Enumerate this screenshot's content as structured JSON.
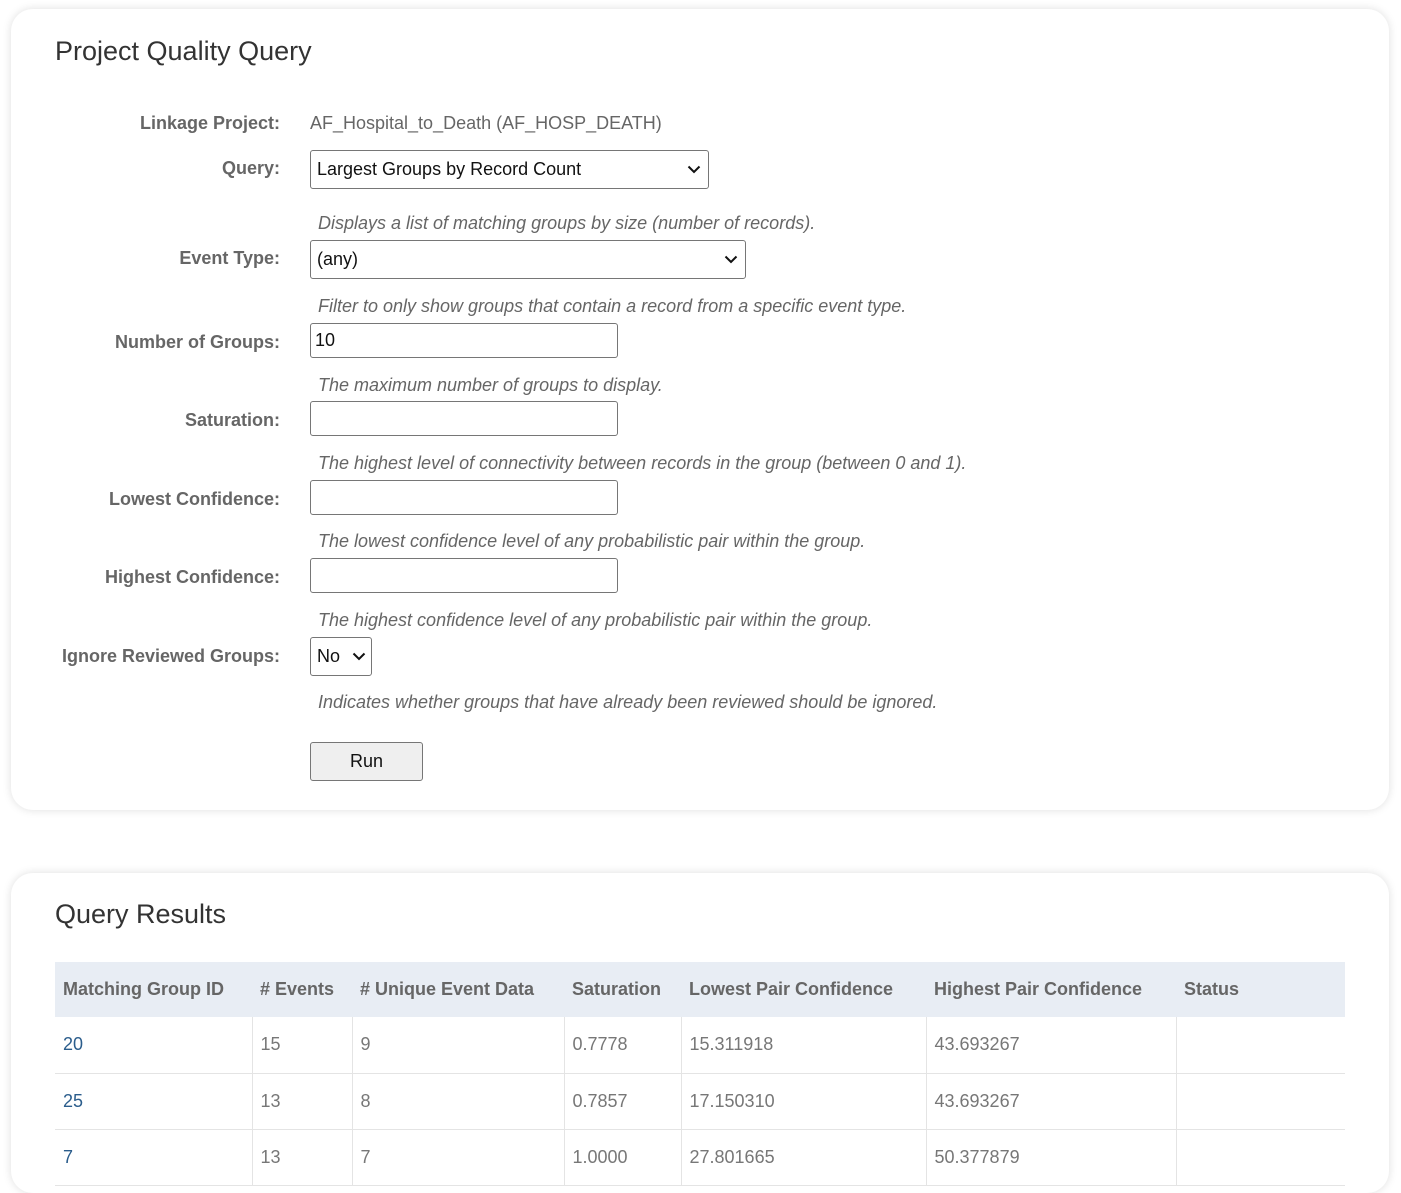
{
  "query_panel": {
    "title": "Project Quality Query",
    "linkage_project": {
      "label": "Linkage Project:",
      "value": "AF_Hospital_to_Death (AF_HOSP_DEATH)"
    },
    "query": {
      "label": "Query:",
      "selected": "Largest Groups by Record Count",
      "hint": "Displays a list of matching groups by size (number of records)."
    },
    "event_type": {
      "label": "Event Type:",
      "selected": "(any)",
      "hint": "Filter to only show groups that contain a record from a specific event type."
    },
    "number_of_groups": {
      "label": "Number of Groups:",
      "value": "10",
      "hint": "The maximum number of groups to display."
    },
    "saturation": {
      "label": "Saturation:",
      "value": "",
      "hint": "The highest level of connectivity between records in the group (between 0 and 1)."
    },
    "lowest_confidence": {
      "label": "Lowest Confidence:",
      "value": "",
      "hint": "The lowest confidence level of any probabilistic pair within the group."
    },
    "highest_confidence": {
      "label": "Highest Confidence:",
      "value": "",
      "hint": "The highest confidence level of any probabilistic pair within the group."
    },
    "ignore_reviewed": {
      "label": "Ignore Reviewed Groups:",
      "selected": "No",
      "hint": "Indicates whether groups that have already been reviewed should be ignored."
    },
    "run_label": "Run"
  },
  "results_panel": {
    "title": "Query Results",
    "columns": [
      "Matching Group ID",
      "# Events",
      "# Unique Event Data",
      "Saturation",
      "Lowest Pair Confidence",
      "Highest Pair Confidence",
      "Status"
    ],
    "rows": [
      [
        "20",
        "15",
        "9",
        "0.7778",
        "15.311918",
        "43.693267",
        ""
      ],
      [
        "25",
        "13",
        "8",
        "0.7857",
        "17.150310",
        "43.693267",
        ""
      ],
      [
        "7",
        "13",
        "7",
        "1.0000",
        "27.801665",
        "50.377879",
        ""
      ]
    ]
  }
}
